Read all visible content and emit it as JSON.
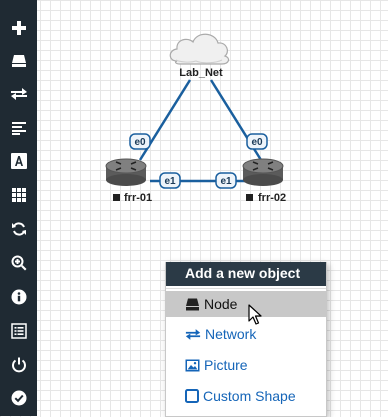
{
  "topology": {
    "cloud": {
      "label": "Lab_Net"
    },
    "routers": [
      {
        "label": "frr-01"
      },
      {
        "label": "frr-02"
      }
    ],
    "interfaces": [
      "e0",
      "e0",
      "e1",
      "e1"
    ]
  },
  "menu": {
    "title": "Add a new object",
    "items": [
      {
        "label": "Node",
        "icon": "node-icon",
        "highlighted": true
      },
      {
        "label": "Network",
        "icon": "network-icon"
      },
      {
        "label": "Picture",
        "icon": "picture-icon"
      },
      {
        "label": "Custom Shape",
        "icon": "custom-shape-icon"
      }
    ]
  },
  "sidebar": {
    "buttons": [
      "add-icon",
      "node-icon",
      "network-icon",
      "list-icon",
      "text-icon",
      "grid-icon",
      "refresh-icon",
      "zoom-icon",
      "info-icon",
      "log-icon",
      "power-icon",
      "check-icon"
    ]
  },
  "colors": {
    "sidebar_bg": "#1f2a33",
    "link": "#1a5f9e",
    "menu_header_bg": "#2b3a46",
    "menu_link": "#1565b8",
    "menu_hover_bg": "#c8c8c8"
  }
}
